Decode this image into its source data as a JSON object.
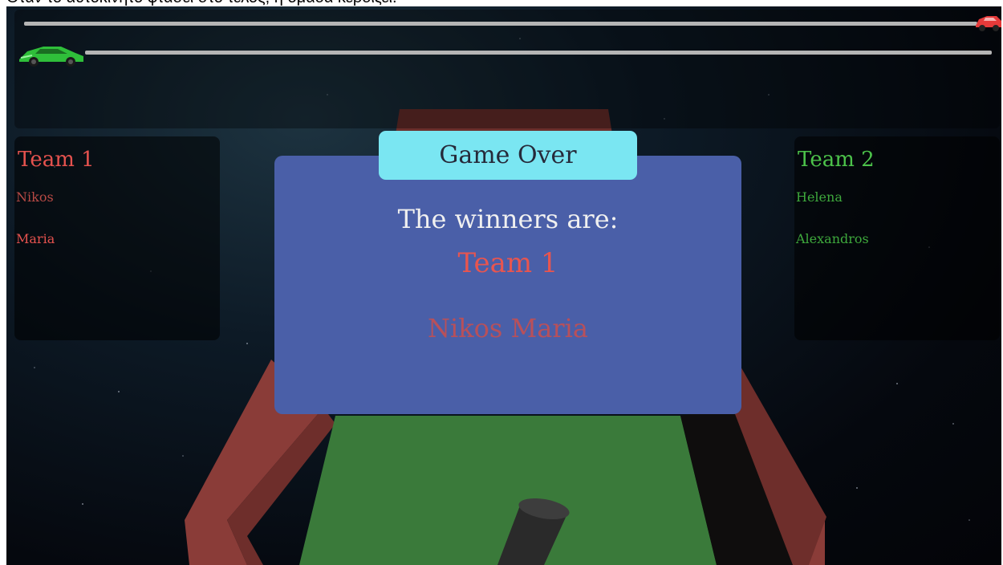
{
  "caption": "Όταν το αυτοκίνητο φτάσει στο τέλος, η ομάδα κερδίζει.",
  "progress": {
    "team1_car_color": "#e53a3a",
    "team2_car_color": "#2fbf3a"
  },
  "team1": {
    "title": "Team 1",
    "color": "#e5524e",
    "players": [
      "Nikos",
      "Maria"
    ]
  },
  "team2": {
    "title": "Team 2",
    "color": "#4cc24a",
    "players": [
      "Helena",
      "Alexandros"
    ]
  },
  "modal": {
    "header": "Game Over",
    "winners_label": "The winners are:",
    "winner_team": "Team 1",
    "winner_players": "Nikos Maria"
  }
}
